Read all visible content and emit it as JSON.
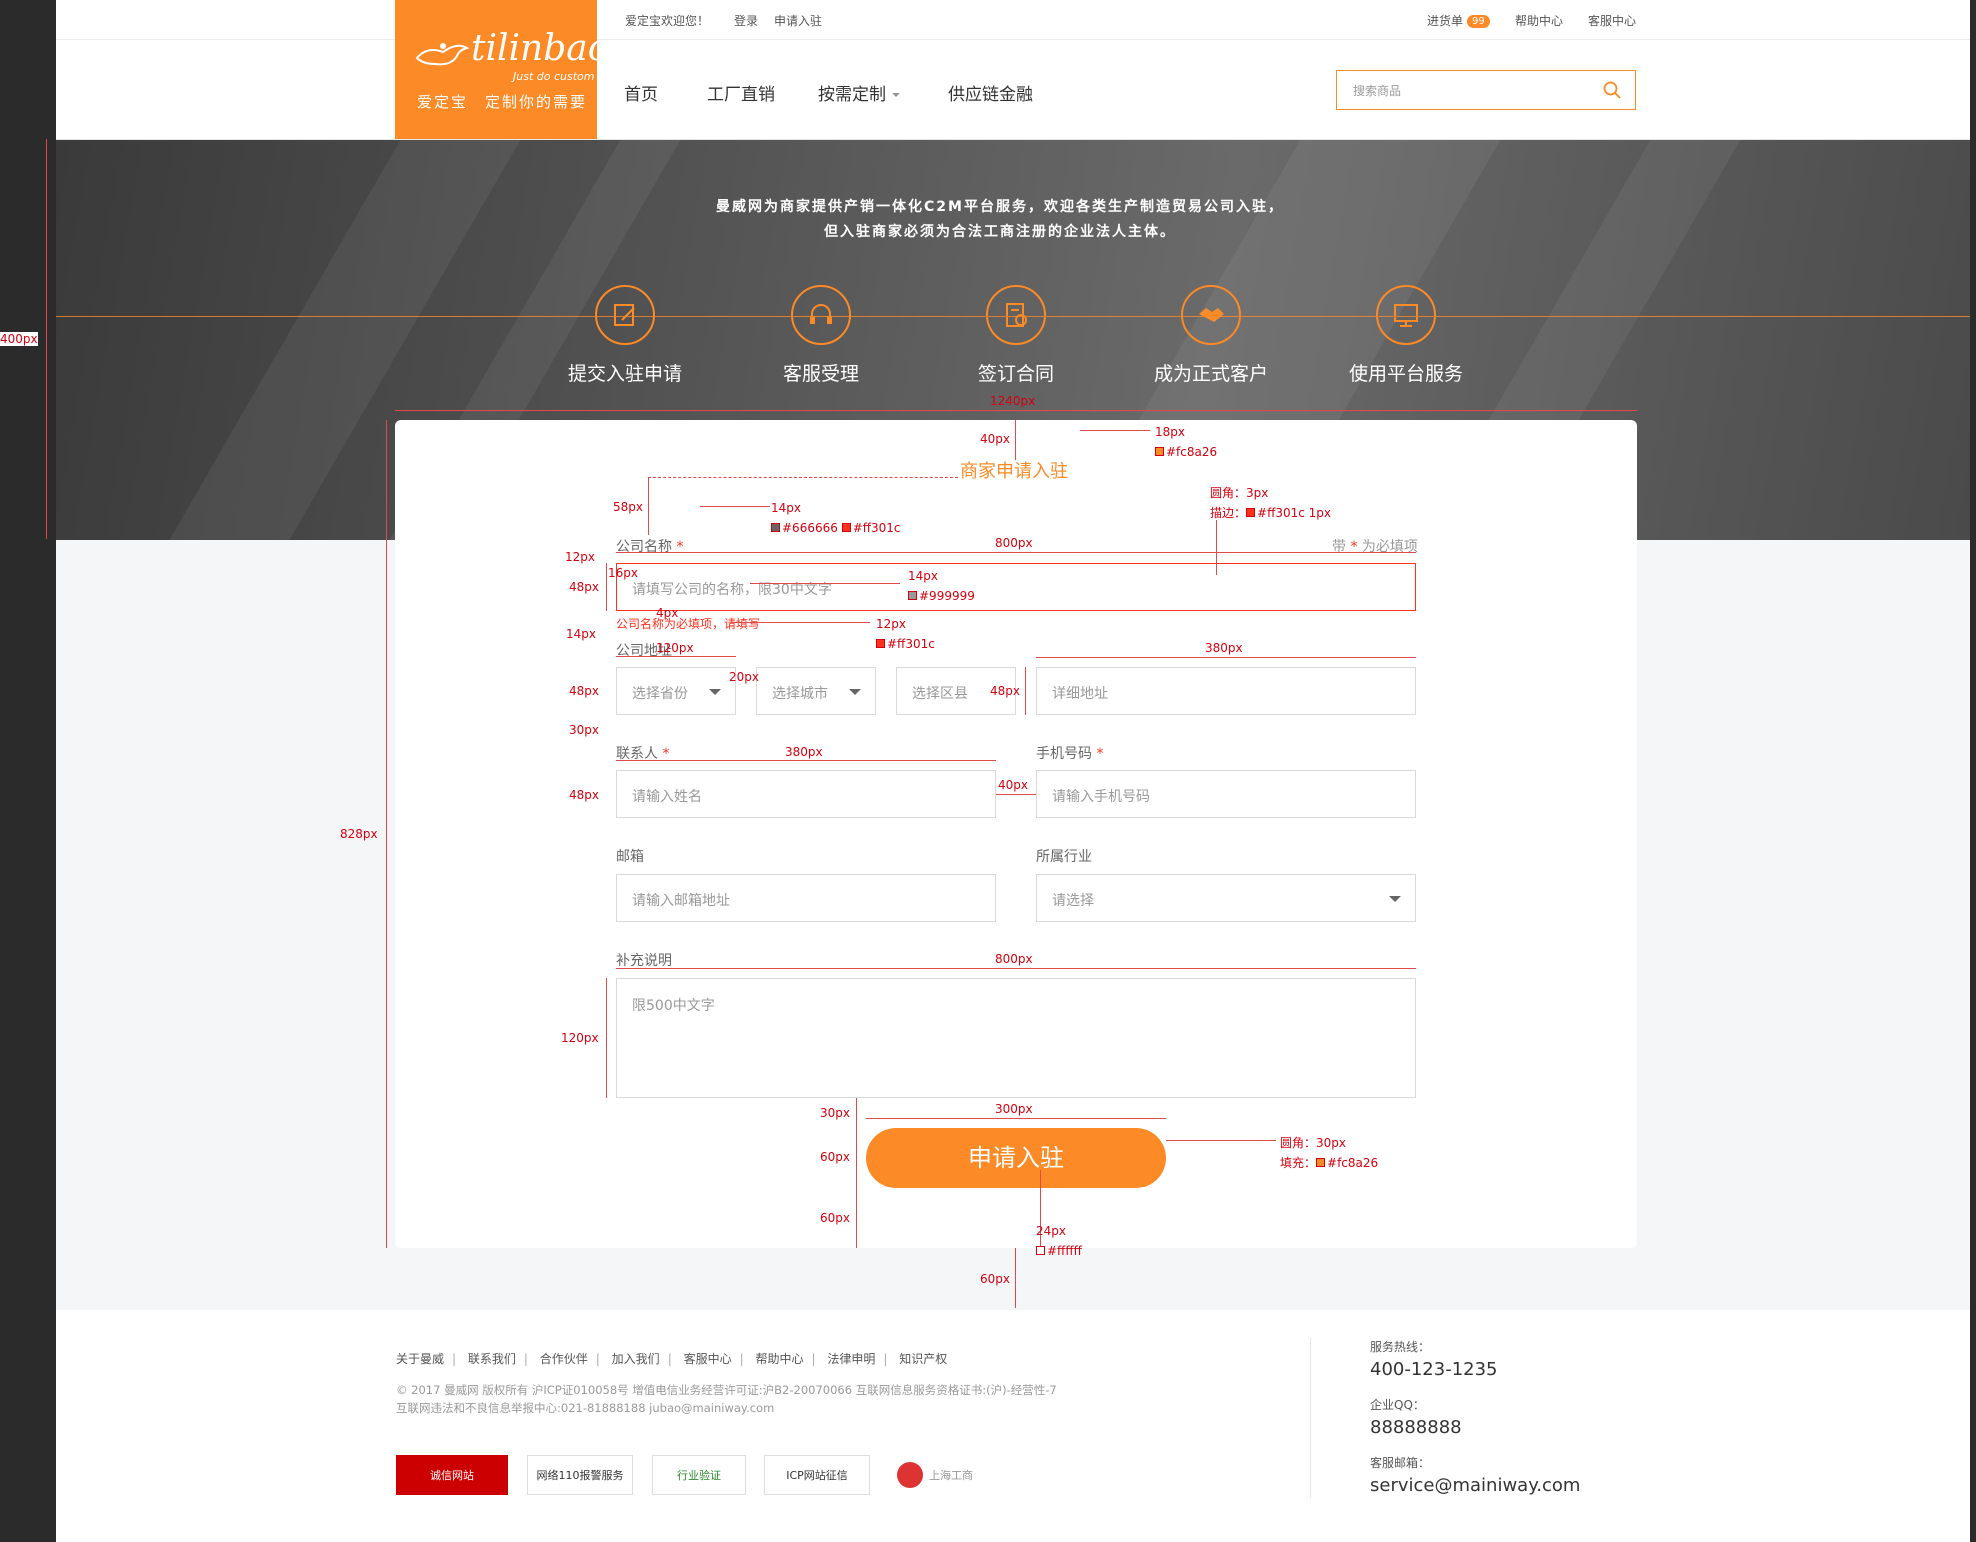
{
  "header": {
    "welcome": "爱定宝欢迎您！",
    "login": "登录",
    "apply": "申请入驻",
    "cart": "进货单",
    "cart_badge": "99",
    "help": "帮助中心",
    "service": "客服中心",
    "brand": "tilinbao",
    "brand_tag": "Just do custom",
    "slogan": "爱定宝　定制你的需要",
    "nav": [
      "首页",
      "工厂直销",
      "按需定制",
      "供应链金融"
    ],
    "search_placeholder": "搜索商品"
  },
  "banner": {
    "line1": "曼威网为商家提供产销一体化C2M平台服务，欢迎各类生产制造贸易公司入驻，",
    "line2": "但入驻商家必须为合法工商注册的企业法人主体。",
    "steps": [
      "提交入驻申请",
      "客服受理",
      "签订合同",
      "成为正式客户",
      "使用平台服务"
    ],
    "step_icons": [
      "edit-icon",
      "headset-icon",
      "contract-icon",
      "handshake-icon",
      "monitor-icon"
    ]
  },
  "form": {
    "title": "商家申请入驻",
    "required_note_pre": "带",
    "required_note_star": "*",
    "required_note_post": "为必填项",
    "company_label": "公司名称",
    "star": "*",
    "company_placeholder": "请填写公司的名称，限30中文字",
    "company_error": "公司名称为必填项，请填写",
    "address_label": "公司地址",
    "province": "选择省份",
    "city": "选择城市",
    "district": "选择区县",
    "detail_address": "详细地址",
    "contact_label": "联系人",
    "contact_placeholder": "请输入姓名",
    "phone_label": "手机号码",
    "phone_placeholder": "请输入手机号码",
    "email_label": "邮箱",
    "email_placeholder": "请输入邮箱地址",
    "industry_label": "所属行业",
    "industry_placeholder": "请选择",
    "notes_label": "补充说明",
    "notes_placeholder": "限500中文字",
    "submit": "申请入驻"
  },
  "annotations": {
    "a400": "400px",
    "a1240": "1240px",
    "a40": "40px",
    "a18": "18px",
    "c_fc8a26": "#fc8a26",
    "a58": "58px",
    "a14": "14px",
    "c_666": "#666666",
    "c_ff301c": "#ff301c",
    "radius3": "圆角：3px",
    "border": "描边：",
    "border_val": "#ff301c 1px",
    "a12": "12px",
    "a800": "800px",
    "a48": "48px",
    "a16": "16px",
    "a14b": "14px",
    "c_999": "#999999",
    "a4": "4px",
    "a14c": "14px",
    "a12b": "12px",
    "c_ff301c2": "#ff301c",
    "a120": "120px",
    "a380": "380px",
    "a20": "20px",
    "a48b": "48px",
    "a48c": "48px",
    "a30": "30px",
    "a380b": "380px",
    "a48d": "48px",
    "a40b": "40px",
    "a800b": "800px",
    "a120b": "120px",
    "a30b": "30px",
    "a300": "300px",
    "a60": "60px",
    "a60b": "60px",
    "radius30": "圆角：30px",
    "fill": "填充：",
    "fill_val": "#fc8a26",
    "a24": "24px",
    "c_fff": "#ffffff",
    "a828": "828px",
    "a60c": "60px"
  },
  "footer": {
    "links": [
      "关于曼威",
      "联系我们",
      "合作伙伴",
      "加入我们",
      "客服中心",
      "帮助中心",
      "法律申明",
      "知识产权"
    ],
    "copy1": "© 2017 曼威网 版权所有  沪ICP证010058号   增值电信业务经营许可证:沪B2-20070066     互联网信息服务资格证书:(沪)-经营性-7",
    "copy2": "互联网违法和不良信息举报中心:021-81888188 jubao@mainiway.com",
    "certs": [
      "诚信网站",
      "网络110报警服务",
      "行业验证",
      "ICP网站征信",
      "上海工商"
    ],
    "hotline_label": "服务热线：",
    "hotline": "400-123-1235",
    "qq_label": "企业QQ：",
    "qq": "88888888",
    "mail_label": "客服邮箱：",
    "mail": "service@mainiway.com"
  },
  "colors": {
    "accent": "#fc8a26",
    "error": "#ff301c",
    "annotation": "#d3000f"
  }
}
